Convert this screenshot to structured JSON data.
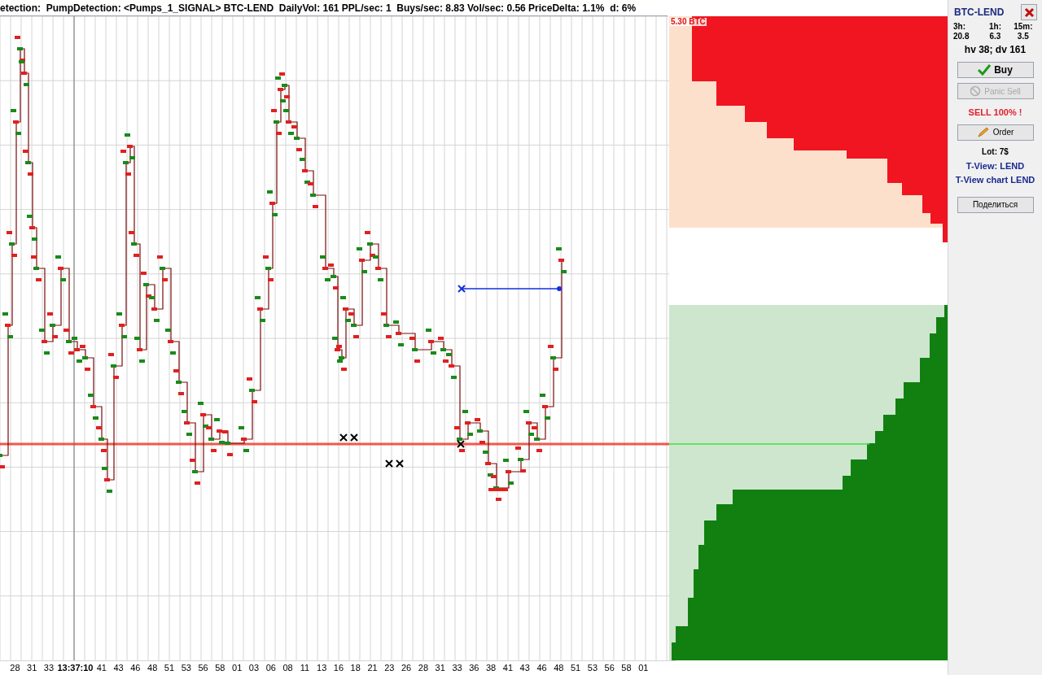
{
  "title_bar": "etection:  PumpDetection: <Pumps_1_SIGNAL> BTC-LEND  DailyVol: 161 PPL/sec: 1  Buys/sec: 8.83 Vol/sec: 0.56 PriceDelta: 1.1%  d: 6%",
  "x_axis_labels": [
    {
      "text": "28",
      "bold": false
    },
    {
      "text": "31",
      "bold": false
    },
    {
      "text": "33",
      "bold": false
    },
    {
      "text": "13:37:10",
      "bold": true
    },
    {
      "text": "41",
      "bold": false
    },
    {
      "text": "43",
      "bold": false
    },
    {
      "text": "46",
      "bold": false
    },
    {
      "text": "48",
      "bold": false
    },
    {
      "text": "51",
      "bold": false
    },
    {
      "text": "53",
      "bold": false
    },
    {
      "text": "56",
      "bold": false
    },
    {
      "text": "58",
      "bold": false
    },
    {
      "text": "01",
      "bold": false
    },
    {
      "text": "03",
      "bold": false
    },
    {
      "text": "06",
      "bold": false
    },
    {
      "text": "08",
      "bold": false
    },
    {
      "text": "11",
      "bold": false
    },
    {
      "text": "13",
      "bold": false
    },
    {
      "text": "16",
      "bold": false
    },
    {
      "text": "18",
      "bold": false
    },
    {
      "text": "21",
      "bold": false
    },
    {
      "text": "23",
      "bold": false
    },
    {
      "text": "26",
      "bold": false
    },
    {
      "text": "28",
      "bold": false
    },
    {
      "text": "31",
      "bold": false
    },
    {
      "text": "33",
      "bold": false
    },
    {
      "text": "36",
      "bold": false
    },
    {
      "text": "38",
      "bold": false
    },
    {
      "text": "41",
      "bold": false
    },
    {
      "text": "43",
      "bold": false
    },
    {
      "text": "46",
      "bold": false
    },
    {
      "text": "48",
      "bold": false
    },
    {
      "text": "51",
      "bold": false
    },
    {
      "text": "53",
      "bold": false
    },
    {
      "text": "56",
      "bold": false
    },
    {
      "text": "58",
      "bold": false
    },
    {
      "text": "01",
      "bold": false
    }
  ],
  "order_book": {
    "label": "5.30 BTC"
  },
  "panel": {
    "pair": "BTC-LEND",
    "stats": [
      {
        "label": "3h:",
        "value": "20.8"
      },
      {
        "label": "1h:",
        "value": "6.3"
      },
      {
        "label": "15m:",
        "value": "3.5"
      }
    ],
    "summary": "hv 38; dv 161",
    "items": [
      {
        "kind": "buy",
        "label": "Buy",
        "disabled": false
      },
      {
        "kind": "panic",
        "label": "Panic Sell",
        "disabled": true
      },
      {
        "kind": "warning",
        "label": "SELL 100% !"
      },
      {
        "kind": "order",
        "label": "Order",
        "disabled": false
      },
      {
        "kind": "text",
        "label": "Lot: 7$"
      },
      {
        "kind": "link",
        "label": "T-View: LEND"
      },
      {
        "kind": "link",
        "label": "T-View chart LEND"
      },
      {
        "kind": "button",
        "label": "Поделиться",
        "disabled": false
      }
    ]
  }
}
